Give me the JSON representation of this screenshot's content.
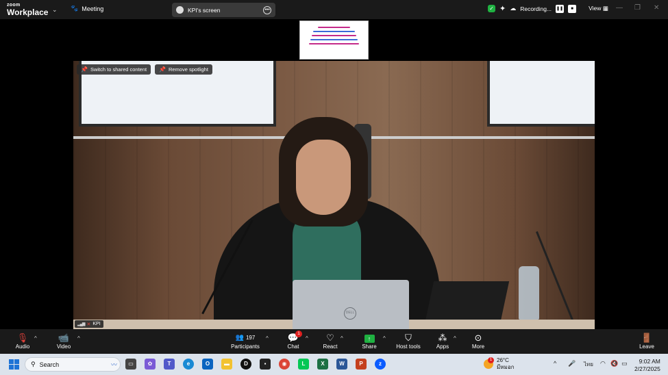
{
  "app": {
    "brand_line1": "zoom",
    "brand_line2": "Workplace",
    "meeting_label": "Meeting",
    "screen_title": "KPI's screen",
    "recording_label": "Recording...",
    "view_label": "View"
  },
  "video": {
    "switch_button": "Switch to shared content",
    "remove_spotlight_button": "Remove spotlight",
    "participant_name": "KPI"
  },
  "toolbar": {
    "audio": "Audio",
    "video": "Video",
    "participants": "Participants",
    "participants_count": "197",
    "chat": "Chat",
    "chat_badge": "1",
    "react": "React",
    "share": "Share",
    "host_tools": "Host tools",
    "apps": "Apps",
    "more": "More",
    "leave": "Leave"
  },
  "taskbar": {
    "search_placeholder": "Search",
    "weather_temp": "26°C",
    "weather_badge": "1",
    "weather_desc": "มีหมอก",
    "language": "ไทย",
    "time": "9:02 AM",
    "date": "2/27/2025"
  },
  "colors": {
    "zoom_green": "#1fb141",
    "alert_red": "#e02020",
    "toolbar_bg": "#1a1a1a",
    "taskbar_bg": "#dce3ec"
  }
}
